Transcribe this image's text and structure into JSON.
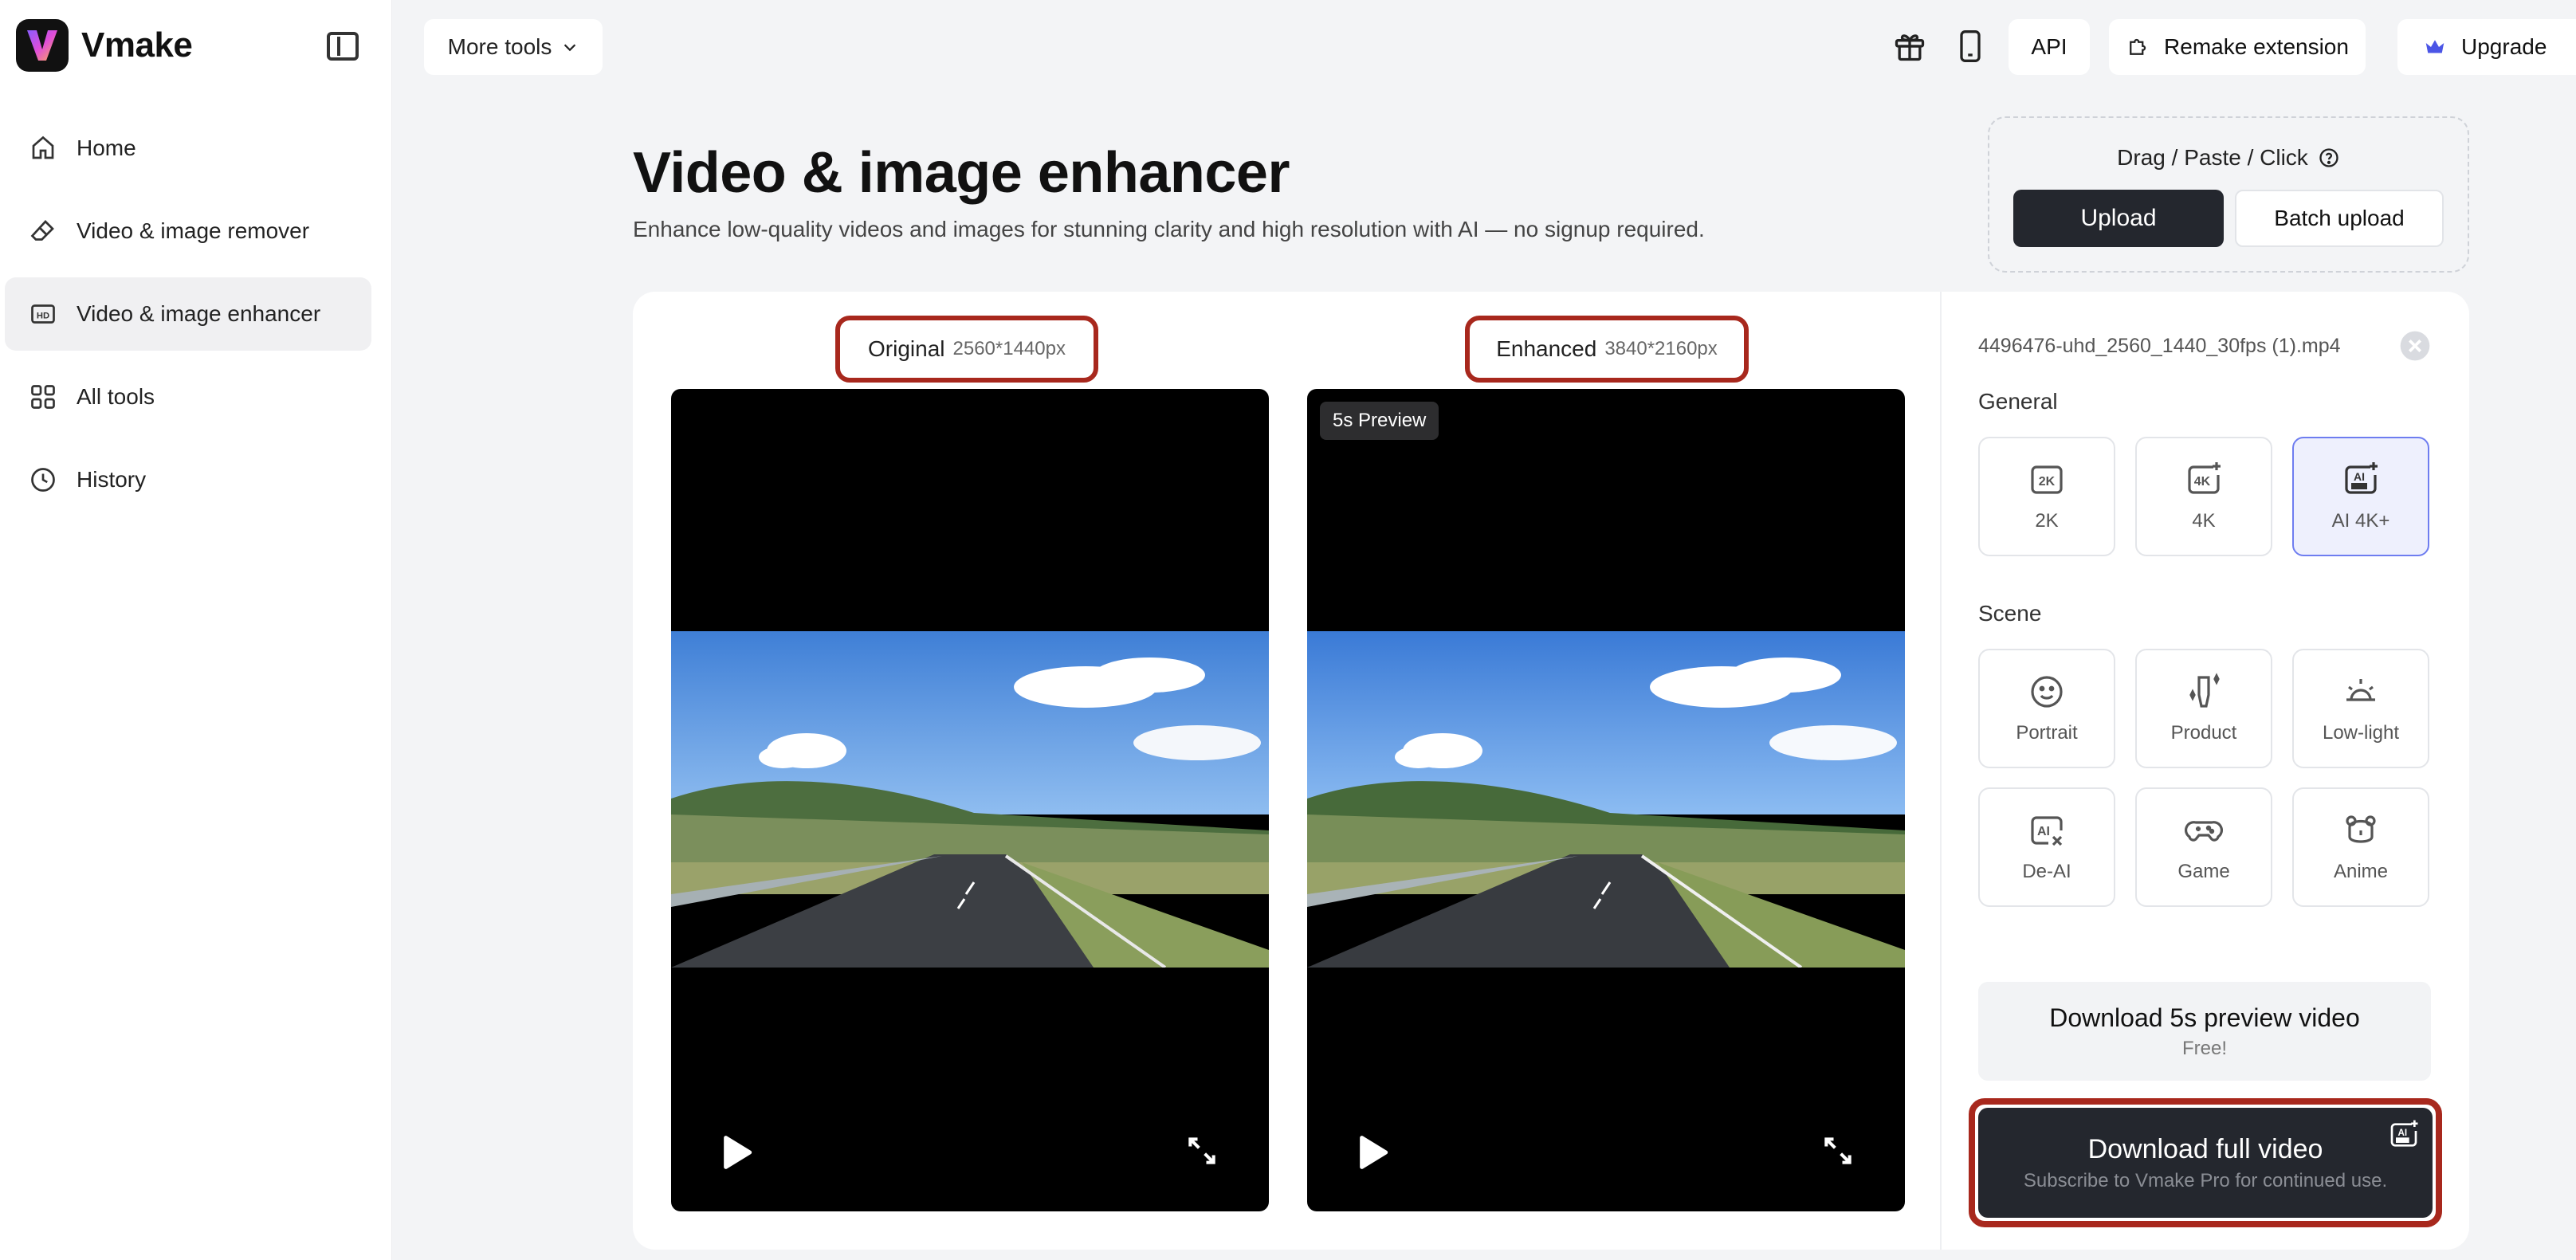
{
  "app": {
    "name": "Vmake"
  },
  "sidebar": {
    "items": [
      {
        "label": "Home",
        "icon": "home-icon"
      },
      {
        "label": "Video & image remover",
        "icon": "eraser-icon"
      },
      {
        "label": "Video & image enhancer",
        "icon": "hd-icon",
        "active": true
      },
      {
        "label": "All tools",
        "icon": "grid-icon"
      },
      {
        "label": "History",
        "icon": "clock-icon"
      }
    ]
  },
  "topbar": {
    "more_tools": "More tools",
    "api": "API",
    "remake_extension": "Remake extension",
    "upgrade": "Upgrade"
  },
  "header": {
    "title": "Video & image enhancer",
    "subtitle": "Enhance low-quality videos and images for stunning clarity and high resolution with AI — no signup required."
  },
  "upload": {
    "hint": "Drag / Paste / Click",
    "upload_label": "Upload",
    "batch_label": "Batch upload"
  },
  "compare": {
    "original_label": "Original",
    "original_dim": "2560*1440px",
    "enhanced_label": "Enhanced",
    "enhanced_dim": "3840*2160px",
    "preview_badge": "5s Preview"
  },
  "settings": {
    "file_name": "4496476-uhd_2560_1440_30fps (1).mp4",
    "general_label": "General",
    "general_options": [
      {
        "label": "2K",
        "icon": "2k-icon"
      },
      {
        "label": "4K",
        "icon": "4k-icon"
      },
      {
        "label": "AI 4K+",
        "icon": "ai-ultra-icon",
        "selected": true
      }
    ],
    "scene_label": "Scene",
    "scene_options": [
      {
        "label": "Portrait",
        "icon": "smiley-icon"
      },
      {
        "label": "Product",
        "icon": "product-icon"
      },
      {
        "label": "Low-light",
        "icon": "sunrise-icon"
      },
      {
        "label": "De-AI",
        "icon": "de-ai-icon"
      },
      {
        "label": "Game",
        "icon": "gamepad-icon"
      },
      {
        "label": "Anime",
        "icon": "bear-icon"
      }
    ],
    "download_preview_title": "Download 5s preview video",
    "download_preview_sub": "Free!",
    "download_full_title": "Download full video",
    "download_full_sub": "Subscribe to Vmake Pro for continued use."
  },
  "colors": {
    "accent_dark": "#24272e",
    "highlight_red": "#a8281d",
    "selected_blue": "#6e7df0"
  }
}
